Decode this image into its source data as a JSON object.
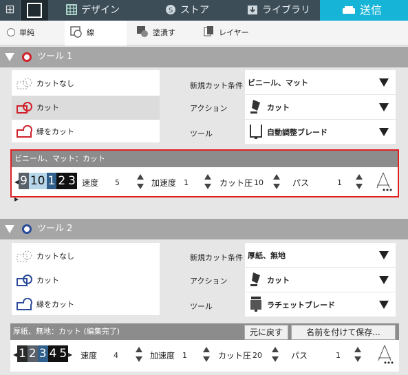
{
  "nav": {
    "home_glyph": "⊞",
    "tabs": [
      {
        "label": "デザイン",
        "icon": "grid-icon"
      },
      {
        "label": "ストア",
        "icon": "store-icon"
      },
      {
        "label": "ライブラリ",
        "icon": "download-icon"
      },
      {
        "label": "送信",
        "icon": "cutter-icon"
      }
    ],
    "active_tab": "送信"
  },
  "styles": [
    {
      "label": "単純",
      "icon": "radio-icon"
    },
    {
      "label": "線",
      "icon": "line-icon"
    },
    {
      "label": "塗潰す",
      "icon": "fill-icon"
    },
    {
      "label": "レイヤー",
      "icon": "layer-icon"
    }
  ],
  "tool1": {
    "title": "ツール 1",
    "ring_color": "#d0202a",
    "options": [
      "カットなし",
      "カット",
      "縁をカット"
    ],
    "selected_option": "カット",
    "material_label": "新規カット条件",
    "material_value": "ビニール、マット",
    "action_label": "アクション",
    "action_value": "カット",
    "tool_label": "ツール",
    "tool_value": "自動調整ブレード",
    "settings_title": "ビニール、マット：カット",
    "blade": [
      "9",
      "10",
      "1",
      "2",
      "3"
    ],
    "speed_label": "速度",
    "speed": "5",
    "accel_label": "加速度",
    "accel": "1",
    "force_label": "カット圧",
    "force": "10",
    "passes_label": "パス",
    "passes": "1"
  },
  "tool2": {
    "title": "ツール 2",
    "ring_color": "#2a4a9a",
    "options": [
      "カットなし",
      "カット",
      "縁をカット"
    ],
    "material_label": "新規カット条件",
    "material_value": "厚紙、無地",
    "action_label": "アクション",
    "action_value": "カット",
    "tool_label": "ツール",
    "tool_value": "ラチェットブレード",
    "settings_title": "厚紙、無地：カット (編集完了)",
    "revert_label": "元に戻す",
    "save_label": "名前を付けて保存...",
    "blade": [
      "1",
      "2",
      "3",
      "4",
      "5"
    ],
    "speed_label": "速度",
    "speed": "4",
    "accel_label": "加速度",
    "accel": "1",
    "force_label": "カット圧",
    "force": "20",
    "passes_label": "パス",
    "passes": "1"
  },
  "colors": {
    "accent": "#16b4d6",
    "nav_bg": "#3d4d57",
    "highlight": "#e02020"
  }
}
